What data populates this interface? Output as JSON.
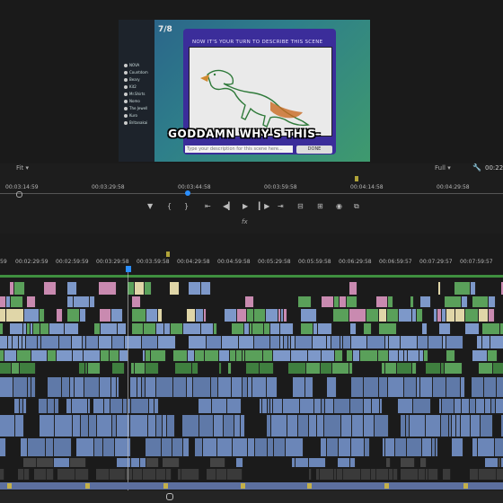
{
  "monitor": {
    "round_counter": "7/8",
    "card_title": "NOW IT'S YOUR TURN TO DESCRIBE THIS SCENE",
    "input_placeholder": "Type your description for this scene here...",
    "done_label": "DONE",
    "caption": "GODDAMN WHY'S THIS-",
    "players": [
      "NOVA",
      "Countdom",
      "Beary",
      "Kit2",
      "Mr.Shirts",
      "Nomo",
      "The Jewell",
      "Kuro",
      "Britanakai"
    ],
    "zoom_label": "Fit",
    "quality_label": "Full",
    "timecode_right": "00:22",
    "ruler_ticks": [
      "00:03:14:59",
      "00:03:29:58",
      "00:03:44:58",
      "00:03:59:58",
      "00:04:14:58",
      "00:04:29:58"
    ],
    "accent": "#2b8fff"
  },
  "transport": {
    "buttons": [
      "marker-icon",
      "mark-in-icon",
      "mark-out-icon",
      "go-to-in-icon",
      "step-back-icon",
      "play-icon",
      "step-forward-icon",
      "go-to-out-icon",
      "lift-icon",
      "extract-icon",
      "camera-icon",
      "compare-icon"
    ],
    "glyphs": [
      "▼",
      "{",
      "}",
      "⇤",
      "◀▎",
      "▶",
      "▎▶",
      "⇥",
      "⊟",
      "⊞",
      "◉",
      "⧉"
    ],
    "fx": "fx"
  },
  "timeline": {
    "ruler_ticks": [
      "59",
      "00:02:29:59",
      "00:02:59:59",
      "00:03:29:58",
      "00:03:59:58",
      "00:04:29:58",
      "00:04:59:58",
      "00:05:29:58",
      "00:05:59:58",
      "00:06:29:58",
      "00:06:59:57",
      "00:07:29:57",
      "00:07:59:57"
    ],
    "colors": {
      "video_blue": "#7d98c9",
      "video_green": "#5aa05a",
      "audio_blue": "#6b86b8",
      "pink": "#c98ab0",
      "gold": "#c4b048"
    }
  }
}
